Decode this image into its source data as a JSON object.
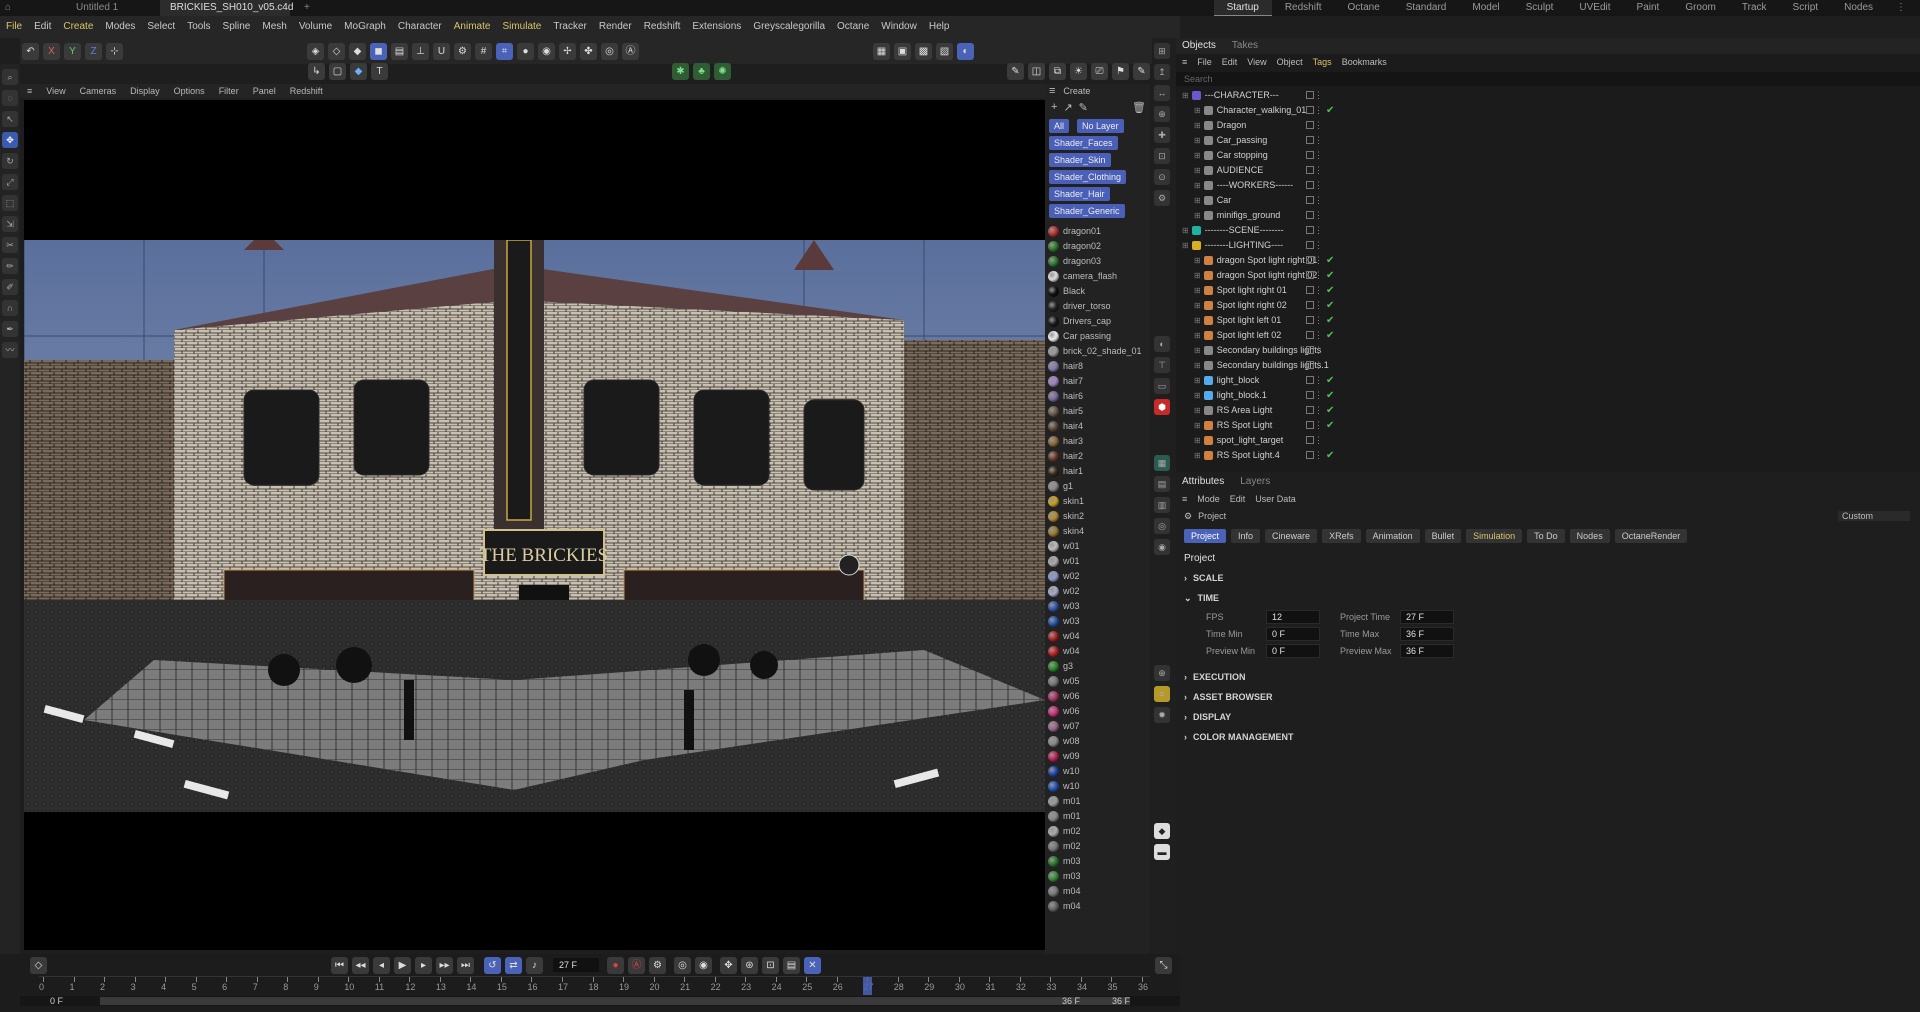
{
  "titlebar": {
    "tabs": [
      "Untitled 1",
      "BRICKIES_SH010_v05.c4d *"
    ],
    "add": "+",
    "layouts": [
      "Startup",
      "Redshift",
      "Octane",
      "Standard",
      "Model",
      "Sculpt",
      "UVEdit",
      "Paint",
      "Groom",
      "Track",
      "Script",
      "Nodes"
    ]
  },
  "menu": [
    "File",
    "Edit",
    "Create",
    "Modes",
    "Select",
    "Tools",
    "Spline",
    "Mesh",
    "Volume",
    "MoGraph",
    "Character",
    "Animate",
    "Simulate",
    "Tracker",
    "Render",
    "Redshift",
    "Extensions",
    "Greyscalegorilla",
    "Octane",
    "Window",
    "Help"
  ],
  "menu_highlight": [
    "Create",
    "Animate",
    "Simulate",
    "File"
  ],
  "viewport": {
    "menu": [
      "View",
      "Cameras",
      "Display",
      "Options",
      "Filter",
      "Panel",
      "Redshift"
    ],
    "sign": "THE BRICKIES"
  },
  "materials": {
    "header": "Create",
    "chips": [
      "All",
      "No Layer",
      "Shader_Faces",
      "Shader_Skin",
      "Shader_Clothing",
      "Shader_Hair",
      "Shader_Generic"
    ],
    "items": [
      {
        "n": "dragon01",
        "c": "#b83030"
      },
      {
        "n": "dragon02",
        "c": "#2e7a2e"
      },
      {
        "n": "dragon03",
        "c": "#2e7a2e"
      },
      {
        "n": "camera_flash",
        "c": "#dddddd"
      },
      {
        "n": "Black",
        "c": "#111111"
      },
      {
        "n": "driver_torso",
        "c": "#222222"
      },
      {
        "n": "Drivers_cap",
        "c": "#1a1a1a"
      },
      {
        "n": "Car passing",
        "c": "#eeeeee"
      },
      {
        "n": "brick_02_shade_01",
        "c": "#999999"
      },
      {
        "n": "hair8",
        "c": "#8877aa"
      },
      {
        "n": "hair7",
        "c": "#a080c0"
      },
      {
        "n": "hair6",
        "c": "#7a6a9a"
      },
      {
        "n": "hair5",
        "c": "#6a5a4a"
      },
      {
        "n": "hair4",
        "c": "#5a4a3a"
      },
      {
        "n": "hair3",
        "c": "#8a6a3a"
      },
      {
        "n": "hair2",
        "c": "#6a3a2a"
      },
      {
        "n": "hair1",
        "c": "#3a2a1a"
      },
      {
        "n": "g1",
        "c": "#8a8a8a"
      },
      {
        "n": "skin1",
        "c": "#c8a020"
      },
      {
        "n": "skin2",
        "c": "#b08a30"
      },
      {
        "n": "skin4",
        "c": "#9a7a30"
      },
      {
        "n": "w01",
        "c": "#bcbcbc"
      },
      {
        "n": "w01",
        "c": "#aaaaaa"
      },
      {
        "n": "w02",
        "c": "#8899cc"
      },
      {
        "n": "w02",
        "c": "#aaaacc"
      },
      {
        "n": "w03",
        "c": "#3355aa"
      },
      {
        "n": "w03",
        "c": "#2255aa"
      },
      {
        "n": "w04",
        "c": "#aa2222"
      },
      {
        "n": "w04",
        "c": "#bb2222"
      },
      {
        "n": "g3",
        "c": "#2a8a2a"
      },
      {
        "n": "w05",
        "c": "#777777"
      },
      {
        "n": "w06",
        "c": "#aa3366"
      },
      {
        "n": "w06",
        "c": "#cc3377"
      },
      {
        "n": "w07",
        "c": "#996688"
      },
      {
        "n": "w08",
        "c": "#888888"
      },
      {
        "n": "w09",
        "c": "#bb2255"
      },
      {
        "n": "w10",
        "c": "#2244aa"
      },
      {
        "n": "w10",
        "c": "#2255bb"
      },
      {
        "n": "m01",
        "c": "#999999"
      },
      {
        "n": "m01",
        "c": "#888888"
      },
      {
        "n": "m02",
        "c": "#aaaaaa"
      },
      {
        "n": "m02",
        "c": "#777777"
      },
      {
        "n": "m03",
        "c": "#2a7a2a"
      },
      {
        "n": "m03",
        "c": "#3a8a3a"
      },
      {
        "n": "m04",
        "c": "#777777"
      },
      {
        "n": "m04",
        "c": "#666666"
      }
    ]
  },
  "objects": {
    "tabs": [
      "Objects",
      "Takes"
    ],
    "menu": [
      "File",
      "Edit",
      "View",
      "Object",
      "Tags",
      "Bookmarks"
    ],
    "search": "Search",
    "items": [
      {
        "n": "---CHARACTER---",
        "c": "#6a5acd",
        "ind": 0,
        "chk": false
      },
      {
        "n": "Character_walking_01",
        "c": "#888",
        "ind": 1,
        "chk": true
      },
      {
        "n": "Dragon",
        "c": "#888",
        "ind": 1,
        "chk": false
      },
      {
        "n": "Car_passing",
        "c": "#888",
        "ind": 1,
        "chk": false
      },
      {
        "n": "Car stopping",
        "c": "#888",
        "ind": 1,
        "chk": false
      },
      {
        "n": "AUDIENCE",
        "c": "#888",
        "ind": 1,
        "chk": false
      },
      {
        "n": "----WORKERS------",
        "c": "#888",
        "ind": 1,
        "chk": false
      },
      {
        "n": "Car",
        "c": "#888",
        "ind": 1,
        "chk": false
      },
      {
        "n": "minifigs_ground",
        "c": "#888",
        "ind": 1,
        "chk": false
      },
      {
        "n": "--------SCENE--------",
        "c": "#20b0a0",
        "ind": 0,
        "chk": false
      },
      {
        "n": "--------LIGHTING----",
        "c": "#d8b020",
        "ind": 0,
        "chk": false
      },
      {
        "n": "dragon Spot light right 01",
        "c": "#d08040",
        "ind": 1,
        "chk": true
      },
      {
        "n": "dragon Spot light right 02",
        "c": "#d08040",
        "ind": 1,
        "chk": true
      },
      {
        "n": "Spot light right 01",
        "c": "#d08040",
        "ind": 1,
        "chk": true
      },
      {
        "n": "Spot light right 02",
        "c": "#d08040",
        "ind": 1,
        "chk": true
      },
      {
        "n": "Spot light left 01",
        "c": "#d08040",
        "ind": 1,
        "chk": true
      },
      {
        "n": "Spot light left 02",
        "c": "#d08040",
        "ind": 1,
        "chk": true
      },
      {
        "n": "Secondary buildings lights",
        "c": "#888",
        "ind": 1,
        "chk": false
      },
      {
        "n": "Secondary buildings lights.1",
        "c": "#888",
        "ind": 1,
        "chk": false
      },
      {
        "n": "light_block",
        "c": "#55aaee",
        "ind": 1,
        "chk": true
      },
      {
        "n": "light_block.1",
        "c": "#55aaee",
        "ind": 1,
        "chk": true
      },
      {
        "n": "RS Area Light",
        "c": "#888",
        "ind": 1,
        "chk": true
      },
      {
        "n": "RS Spot Light",
        "c": "#d08040",
        "ind": 1,
        "chk": true
      },
      {
        "n": "spot_light_target",
        "c": "#d08040",
        "ind": 1,
        "chk": false
      },
      {
        "n": "RS Spot Light.4",
        "c": "#d08040",
        "ind": 1,
        "chk": true
      }
    ]
  },
  "attributes": {
    "tabs": [
      "Attributes",
      "Layers"
    ],
    "menu": [
      "Mode",
      "Edit",
      "User Data"
    ],
    "path": "Project",
    "custom": "Custom",
    "subtabs": [
      "Project",
      "Info",
      "Cineware",
      "XRefs",
      "Animation",
      "Bullet",
      "Simulation",
      "To Do",
      "Nodes",
      "OctaneRender"
    ],
    "title": "Project",
    "scale": "SCALE",
    "time": "TIME",
    "fields": [
      {
        "l": "FPS",
        "v": "12"
      },
      {
        "l": "Project Time",
        "v": "27 F"
      },
      {
        "l": "Time Min",
        "v": "0 F"
      },
      {
        "l": "Time Max",
        "v": "36 F"
      },
      {
        "l": "Preview Min",
        "v": "0 F"
      },
      {
        "l": "Preview Max",
        "v": "36 F"
      }
    ],
    "sections": [
      "EXECUTION",
      "ASSET BROWSER",
      "DISPLAY",
      "COLOR MANAGEMENT"
    ]
  },
  "timeline": {
    "current": "27 F",
    "ticks": [
      "0",
      "1",
      "2",
      "3",
      "4",
      "5",
      "6",
      "7",
      "8",
      "9",
      "10",
      "11",
      "12",
      "13",
      "14",
      "15",
      "16",
      "17",
      "18",
      "19",
      "20",
      "21",
      "22",
      "23",
      "24",
      "25",
      "26",
      "27",
      "28",
      "29",
      "30",
      "31",
      "32",
      "33",
      "34",
      "35",
      "36"
    ],
    "start": "0 F",
    "start2": "0 F",
    "end": "36 F",
    "end2": "36 F",
    "playhead": 27,
    "max": 36
  }
}
